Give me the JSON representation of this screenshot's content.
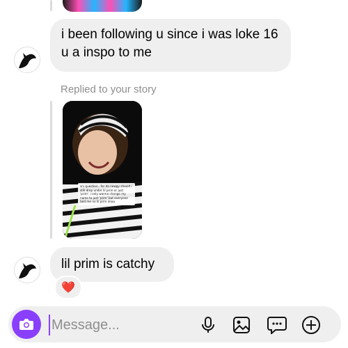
{
  "messages": [
    {
      "text": "i been following u since i was loke 16 u a inspo to me"
    },
    {
      "text": "lil prim is catchy",
      "reaction": "❤️"
    }
  ],
  "reply": {
    "label": "Replied to your story",
    "story_caption": "srs question.. for da newgy should i still drop under lil prim or just 'prim'. i only wanna change my name to just 'prim' but everyone told me no lil prim imao"
  },
  "composer": {
    "placeholder": "Message..."
  },
  "icons": {
    "camera": "camera-icon",
    "mic": "microphone-icon",
    "gallery": "gallery-icon",
    "sticker": "sticker-icon",
    "add": "plus-circle-icon"
  },
  "colors": {
    "accent": "#8a3ffc",
    "bubble": "#efefef",
    "reaction": "#e0245e"
  }
}
